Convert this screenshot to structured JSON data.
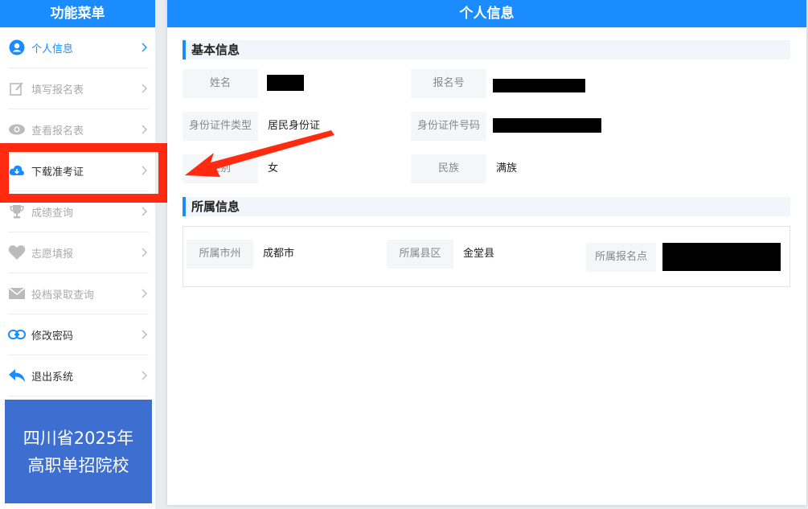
{
  "sidebar": {
    "title": "功能菜单",
    "items": [
      {
        "label": "个人信息",
        "icon": "user-circle-icon"
      },
      {
        "label": "填写报名表",
        "icon": "edit-icon"
      },
      {
        "label": "查看报名表",
        "icon": "eye-icon"
      },
      {
        "label": "下载准考证",
        "icon": "cloud-download-icon"
      },
      {
        "label": "成绩查询",
        "icon": "trophy-icon"
      },
      {
        "label": "志愿填报",
        "icon": "heart-icon"
      },
      {
        "label": "投档录取查询",
        "icon": "mail-icon"
      },
      {
        "label": "修改密码",
        "icon": "link-icon"
      },
      {
        "label": "退出系统",
        "icon": "reply-icon"
      }
    ],
    "promo_line1": "四川省2025年",
    "promo_line2": "高职单招院校"
  },
  "main": {
    "title": "个人信息",
    "basic": {
      "title": "基本信息",
      "name_label": "姓名",
      "regno_label": "报名号",
      "idtype_label": "身份证件类型",
      "idtype_value": "居民身份证",
      "idno_label": "身份证件号码",
      "gender_label": "性别",
      "gender_value": "女",
      "ethnic_label": "民族",
      "ethnic_value": "满族"
    },
    "belong": {
      "title": "所属信息",
      "city_label": "所属市州",
      "city_value": "成都市",
      "county_label": "所属县区",
      "county_value": "金堂县",
      "site_label": "所属报名点"
    }
  },
  "colors": {
    "primary": "#1a8cff",
    "annotation": "#ff2a10",
    "promo": "#3d6fd1"
  }
}
